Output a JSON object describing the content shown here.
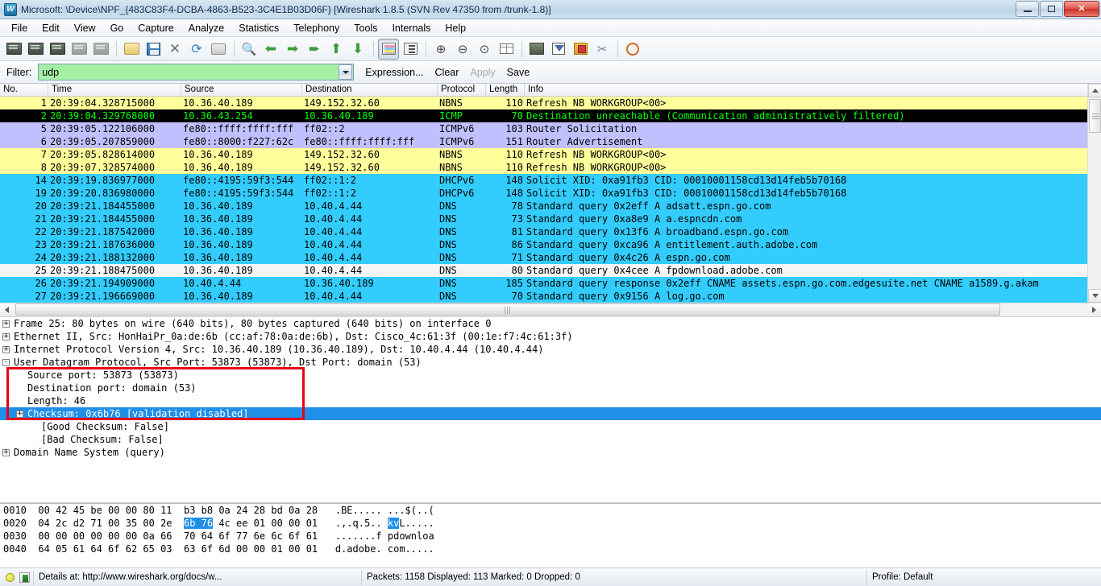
{
  "window": {
    "title": "Microsoft: \\Device\\NPF_{483C83F4-DCBA-4863-B523-3C4E1B03D06F}   [Wireshark 1.8.5  (SVN Rev 47350 from /trunk-1.8)]",
    "icon": "wireshark-logo-icon",
    "minimize_label": "Minimize",
    "maximize_label": "Restore",
    "close_label": "✕"
  },
  "menu": [
    {
      "label": "File",
      "mnemonic": "F"
    },
    {
      "label": "Edit",
      "mnemonic": "E"
    },
    {
      "label": "View",
      "mnemonic": "V"
    },
    {
      "label": "Go",
      "mnemonic": "G"
    },
    {
      "label": "Capture",
      "mnemonic": "C"
    },
    {
      "label": "Analyze",
      "mnemonic": "A"
    },
    {
      "label": "Statistics",
      "mnemonic": "S"
    },
    {
      "label": "Telephony",
      "mnemonic": "y"
    },
    {
      "label": "Tools",
      "mnemonic": "T"
    },
    {
      "label": "Internals",
      "mnemonic": "I"
    },
    {
      "label": "Help",
      "mnemonic": "H"
    }
  ],
  "toolbar": [
    {
      "name": "interfaces-icon",
      "title": "List the available capture interfaces"
    },
    {
      "name": "capture-options-icon",
      "title": "Show the capture options"
    },
    {
      "name": "start-capture-icon",
      "title": "Start a new live capture"
    },
    {
      "name": "stop-capture-icon",
      "title": "Stop the running live capture"
    },
    {
      "name": "restart-capture-icon",
      "title": "Restart the running live capture"
    },
    {
      "name": "open-file-icon",
      "title": "Open a capture file"
    },
    {
      "name": "save-file-icon",
      "title": "Save this capture file"
    },
    {
      "name": "close-file-icon",
      "title": "Close this capture file"
    },
    {
      "name": "reload-file-icon",
      "title": "Reload this capture file"
    },
    {
      "name": "print-icon",
      "title": "Print packets"
    },
    {
      "name": "find-packet-icon",
      "title": "Find a packet"
    },
    {
      "name": "go-back-icon",
      "title": "Go back in packet history"
    },
    {
      "name": "go-forward-icon",
      "title": "Go forward in packet history"
    },
    {
      "name": "go-to-packet-icon",
      "title": "Go to a specific packet"
    },
    {
      "name": "go-first-packet-icon",
      "title": "Go to the first packet"
    },
    {
      "name": "go-last-packet-icon",
      "title": "Go to the last packet"
    },
    {
      "name": "colorize-icon",
      "title": "Colorize packet list",
      "pressed": true
    },
    {
      "name": "auto-scroll-icon",
      "title": "Auto scroll in live capture"
    },
    {
      "name": "zoom-in-icon",
      "title": "Zoom in"
    },
    {
      "name": "zoom-out-icon",
      "title": "Zoom out"
    },
    {
      "name": "zoom-reset-icon",
      "title": "Zoom 1:1"
    },
    {
      "name": "resize-columns-icon",
      "title": "Resize columns"
    },
    {
      "name": "capture-filters-icon",
      "title": "Edit capture filters"
    },
    {
      "name": "display-filters-icon",
      "title": "Edit display filters"
    },
    {
      "name": "coloring-rules-icon",
      "title": "Edit coloring rules"
    },
    {
      "name": "preferences-icon",
      "title": "Edit preferences"
    },
    {
      "name": "help-icon",
      "title": "Show help"
    }
  ],
  "filter_bar": {
    "label": "Filter:",
    "value": "udp",
    "placeholder": "",
    "dropdown_icon": "chevron-down-icon",
    "expression_label": "Expression...",
    "clear_label": "Clear",
    "apply_label": "Apply",
    "save_label": "Save",
    "field_bg": "#a6f0a6"
  },
  "packet_list": {
    "columns": [
      "No.",
      "Time",
      "Source",
      "Destination",
      "Protocol",
      "Length",
      "Info"
    ],
    "rows": [
      {
        "no": "1",
        "time": "20:39:04.328715000",
        "src": "10.36.40.189",
        "dst": "149.152.32.60",
        "proto": "NBNS",
        "len": "110",
        "info": "Refresh NB WORKGROUP<00>",
        "bg": "#ffff9c",
        "fg": "#000000"
      },
      {
        "no": "2",
        "time": "20:39:04.329768000",
        "src": "10.36.43.254",
        "dst": "10.36.40.189",
        "proto": "ICMP",
        "len": "70",
        "info": "Destination unreachable (Communication administratively filtered)",
        "bg": "#000000",
        "fg": "#00ff00"
      },
      {
        "no": "5",
        "time": "20:39:05.122106000",
        "src": "fe80::ffff:ffff:fff",
        "dst": "ff02::2",
        "proto": "ICMPv6",
        "len": "103",
        "info": "Router Solicitation",
        "bg": "#c0c0ff",
        "fg": "#000000"
      },
      {
        "no": "6",
        "time": "20:39:05.207859000",
        "src": "fe80::8000:f227:62c",
        "dst": "fe80::ffff:ffff:fff",
        "proto": "ICMPv6",
        "len": "151",
        "info": "Router Advertisement",
        "bg": "#c0c0ff",
        "fg": "#000000"
      },
      {
        "no": "7",
        "time": "20:39:05.828614000",
        "src": "10.36.40.189",
        "dst": "149.152.32.60",
        "proto": "NBNS",
        "len": "110",
        "info": "Refresh NB WORKGROUP<00>",
        "bg": "#ffff9c",
        "fg": "#000000"
      },
      {
        "no": "8",
        "time": "20:39:07.328574000",
        "src": "10.36.40.189",
        "dst": "149.152.32.60",
        "proto": "NBNS",
        "len": "110",
        "info": "Refresh NB WORKGROUP<00>",
        "bg": "#ffff9c",
        "fg": "#000000"
      },
      {
        "no": "14",
        "time": "20:39:19.836977000",
        "src": "fe80::4195:59f3:544",
        "dst": "ff02::1:2",
        "proto": "DHCPv6",
        "len": "148",
        "info": "Solicit XID: 0xa91fb3 CID: 00010001158cd13d14feb5b70168",
        "bg": "#33ccff",
        "fg": "#000000"
      },
      {
        "no": "19",
        "time": "20:39:20.836980000",
        "src": "fe80::4195:59f3:544",
        "dst": "ff02::1:2",
        "proto": "DHCPv6",
        "len": "148",
        "info": "Solicit XID: 0xa91fb3 CID: 00010001158cd13d14feb5b70168",
        "bg": "#33ccff",
        "fg": "#000000"
      },
      {
        "no": "20",
        "time": "20:39:21.184455000",
        "src": "10.36.40.189",
        "dst": "10.40.4.44",
        "proto": "DNS",
        "len": "78",
        "info": "Standard query 0x2eff  A adsatt.espn.go.com",
        "bg": "#33ccff",
        "fg": "#000000"
      },
      {
        "no": "21",
        "time": "20:39:21.184455000",
        "src": "10.36.40.189",
        "dst": "10.40.4.44",
        "proto": "DNS",
        "len": "73",
        "info": "Standard query 0xa8e9  A a.espncdn.com",
        "bg": "#33ccff",
        "fg": "#000000"
      },
      {
        "no": "22",
        "time": "20:39:21.187542000",
        "src": "10.36.40.189",
        "dst": "10.40.4.44",
        "proto": "DNS",
        "len": "81",
        "info": "Standard query 0x13f6  A broadband.espn.go.com",
        "bg": "#33ccff",
        "fg": "#000000"
      },
      {
        "no": "23",
        "time": "20:39:21.187636000",
        "src": "10.36.40.189",
        "dst": "10.40.4.44",
        "proto": "DNS",
        "len": "86",
        "info": "Standard query 0xca96  A entitlement.auth.adobe.com",
        "bg": "#33ccff",
        "fg": "#000000"
      },
      {
        "no": "24",
        "time": "20:39:21.188132000",
        "src": "10.36.40.189",
        "dst": "10.40.4.44",
        "proto": "DNS",
        "len": "71",
        "info": "Standard query 0x4c26  A espn.go.com",
        "bg": "#33ccff",
        "fg": "#000000"
      },
      {
        "no": "25",
        "time": "20:39:21.188475000",
        "src": "10.36.40.189",
        "dst": "10.40.4.44",
        "proto": "DNS",
        "len": "80",
        "info": "Standard query 0x4cee  A fpdownload.adobe.com",
        "bg": "#f5f5f5",
        "fg": "#000000"
      },
      {
        "no": "26",
        "time": "20:39:21.194909000",
        "src": "10.40.4.44",
        "dst": "10.36.40.189",
        "proto": "DNS",
        "len": "185",
        "info": "Standard query response 0x2eff  CNAME assets.espn.go.com.edgesuite.net CNAME a1589.g.akam",
        "bg": "#33ccff",
        "fg": "#000000"
      },
      {
        "no": "27",
        "time": "20:39:21.196669000",
        "src": "10.36.40.189",
        "dst": "10.40.4.44",
        "proto": "DNS",
        "len": "70",
        "info": "Standard query 0x9156  A log.go.com",
        "bg": "#33ccff",
        "fg": "#000000"
      }
    ]
  },
  "detail_pane": {
    "rows": [
      {
        "expander": "+",
        "indent": 0,
        "text": "Frame 25: 80 bytes on wire (640 bits), 80 bytes captured (640 bits) on interface 0",
        "selected": false
      },
      {
        "expander": "+",
        "indent": 0,
        "text": "Ethernet II, Src: HonHaiPr_0a:de:6b (cc:af:78:0a:de:6b), Dst: Cisco_4c:61:3f (00:1e:f7:4c:61:3f)",
        "selected": false
      },
      {
        "expander": "+",
        "indent": 0,
        "text": "Internet Protocol Version 4, Src: 10.36.40.189 (10.36.40.189), Dst: 10.40.4.44 (10.40.4.44)",
        "selected": false
      },
      {
        "expander": "-",
        "indent": 0,
        "text": "User Datagram Protocol, Src Port: 53873 (53873), Dst Port: domain (53)",
        "selected": false
      },
      {
        "expander": "",
        "indent": 1,
        "text": "Source port: 53873 (53873)",
        "selected": false
      },
      {
        "expander": "",
        "indent": 1,
        "text": "Destination port: domain (53)",
        "selected": false
      },
      {
        "expander": "",
        "indent": 1,
        "text": "Length: 46",
        "selected": false
      },
      {
        "expander": "+",
        "indent": 1,
        "text": "Checksum: 0x6b76 [validation disabled]",
        "selected": true
      },
      {
        "expander": "",
        "indent": 2,
        "text": "[Good Checksum: False]",
        "selected": false
      },
      {
        "expander": "",
        "indent": 2,
        "text": "[Bad Checksum: False]",
        "selected": false
      },
      {
        "expander": "+",
        "indent": 0,
        "text": "Domain Name System (query)",
        "selected": false
      }
    ],
    "highlight_box_color": "#e8001a"
  },
  "hex_pane": {
    "rows": [
      {
        "offset": "0010",
        "hex_a": "00 42 45 be 00 00 80 11",
        "hex_b": "b3 b8 0a 24 28 bd 0a 28",
        "ascii_a": ".BE.....",
        "ascii_b": "...$(..(",
        "sel_start": -1,
        "sel_len": 0
      },
      {
        "offset": "0020",
        "hex_a": "04 2c d2 71 00 35 00 2e",
        "hex_b": "6b 76 4c ee 01 00 00 01",
        "ascii_a": ".,.q.5..",
        "ascii_b": "kvL.....",
        "sel_hex_start": 0,
        "sel_hex_len": 2,
        "sel_ascii_start": 0,
        "sel_ascii_len": 2
      },
      {
        "offset": "0030",
        "hex_a": "00 00 00 00 00 00 0a 66",
        "hex_b": "70 64 6f 77 6e 6c 6f 61",
        "ascii_a": ".......f",
        "ascii_b": "pdownloa",
        "sel_hex_start": -1,
        "sel_hex_len": 0
      },
      {
        "offset": "0040",
        "hex_a": "64 05 61 64 6f 62 65 03",
        "hex_b": "63 6f 6d 00 00 01 00 01",
        "ascii_a": "d.adobe.",
        "ascii_b": "com.....",
        "sel_hex_start": -1,
        "sel_hex_len": 0
      }
    ],
    "selection_color": "#1f8fe8"
  },
  "status_bar": {
    "expert_icon": "expert-info-yellow-icon",
    "capture_file_icon": "capture-file-properties-icon",
    "file_text": "Details at: http://www.wireshark.org/docs/w...",
    "counts_text": "Packets: 1158 Displayed: 113 Marked: 0 Dropped: 0",
    "profile_text": "Profile: Default"
  }
}
